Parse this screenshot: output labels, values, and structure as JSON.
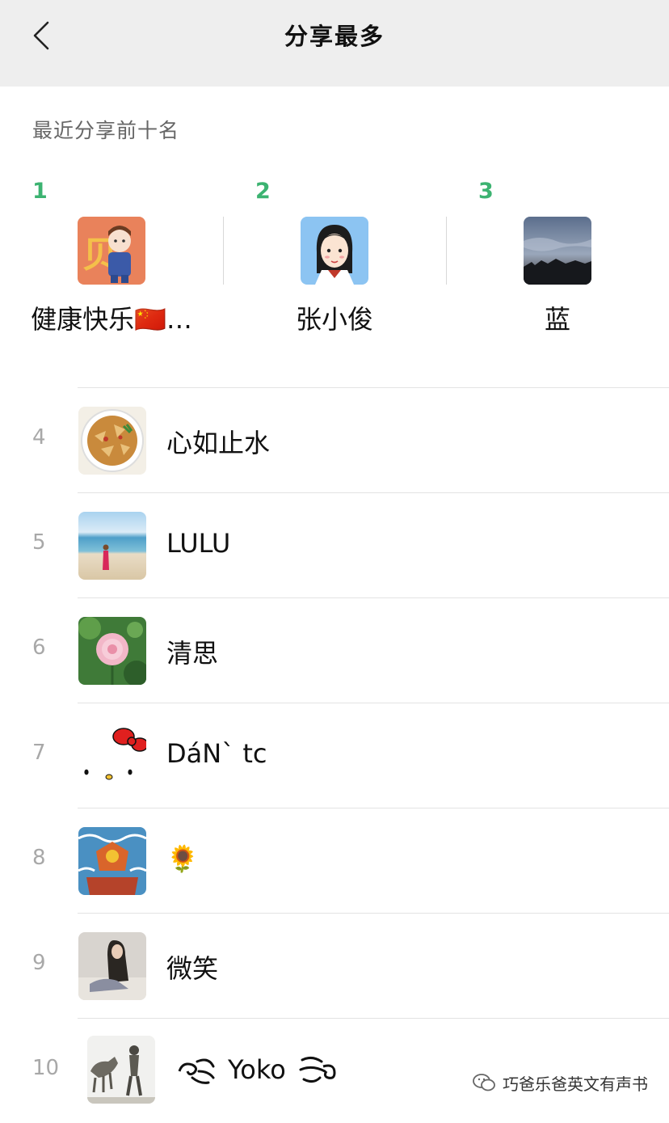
{
  "header": {
    "title": "分享最多"
  },
  "section": {
    "title": "最近分享前十名"
  },
  "podium": [
    {
      "rank": "1",
      "name": "健康快乐🇨🇳…"
    },
    {
      "rank": "2",
      "name": "张小俊"
    },
    {
      "rank": "3",
      "name": "蓝"
    }
  ],
  "list": [
    {
      "rank": "4",
      "name": "心如止水"
    },
    {
      "rank": "5",
      "name": "LULU"
    },
    {
      "rank": "6",
      "name": "清思"
    },
    {
      "rank": "7",
      "name": "DáN` tc"
    },
    {
      "rank": "8",
      "name": "🌻"
    },
    {
      "rank": "9",
      "name": "微笑"
    },
    {
      "rank": "10",
      "name": "Yoko"
    }
  ],
  "watermark": {
    "text": "巧爸乐爸英文有声书"
  },
  "colors": {
    "rank_top": "#3cb371",
    "rank_other": "#a8a8a8",
    "navbar": "#eeeeee"
  }
}
